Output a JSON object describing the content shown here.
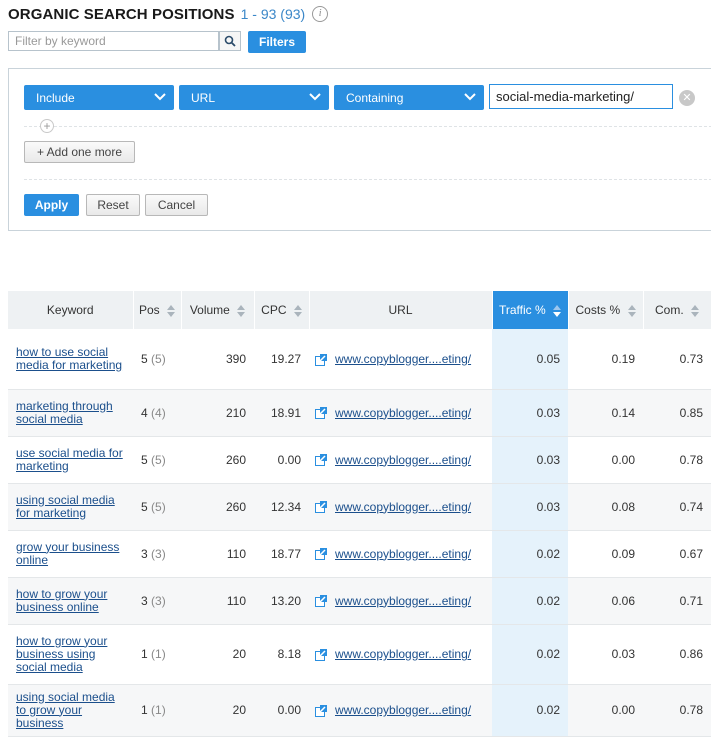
{
  "header": {
    "title": "ORGANIC SEARCH POSITIONS",
    "range": "1 - 93 (93)",
    "info_symbol": "i"
  },
  "search": {
    "placeholder": "Filter by keyword",
    "value": "",
    "filters_label": "Filters"
  },
  "filter_panel": {
    "include": "Include",
    "field": "URL",
    "operator": "Containing",
    "value": "social-media-marketing/",
    "add_symbol": "+",
    "add_one_more": "+ Add one more",
    "apply": "Apply",
    "reset": "Reset",
    "cancel": "Cancel"
  },
  "table": {
    "columns": [
      "Keyword",
      "Pos",
      "Volume",
      "CPC",
      "URL",
      "Traffic %",
      "Costs %",
      "Com."
    ],
    "rows": [
      {
        "keyword": "how to use social media for marketing",
        "pos": "5",
        "pos_prev": "(5)",
        "volume": "390",
        "cpc": "19.27",
        "url": "www.copyblogger....eting/",
        "traffic": "0.05",
        "costs": "0.19",
        "com": "0.73"
      },
      {
        "keyword": "marketing through social media",
        "pos": "4",
        "pos_prev": "(4)",
        "volume": "210",
        "cpc": "18.91",
        "url": "www.copyblogger....eting/",
        "traffic": "0.03",
        "costs": "0.14",
        "com": "0.85"
      },
      {
        "keyword": "use social media for marketing",
        "pos": "5",
        "pos_prev": "(5)",
        "volume": "260",
        "cpc": "0.00",
        "url": "www.copyblogger....eting/",
        "traffic": "0.03",
        "costs": "0.00",
        "com": "0.78"
      },
      {
        "keyword": "using social media for marketing",
        "pos": "5",
        "pos_prev": "(5)",
        "volume": "260",
        "cpc": "12.34",
        "url": "www.copyblogger....eting/",
        "traffic": "0.03",
        "costs": "0.08",
        "com": "0.74"
      },
      {
        "keyword": "grow your business online",
        "pos": "3",
        "pos_prev": "(3)",
        "volume": "110",
        "cpc": "18.77",
        "url": "www.copyblogger....eting/",
        "traffic": "0.02",
        "costs": "0.09",
        "com": "0.67"
      },
      {
        "keyword": "how to grow your business online",
        "pos": "3",
        "pos_prev": "(3)",
        "volume": "110",
        "cpc": "13.20",
        "url": "www.copyblogger....eting/",
        "traffic": "0.02",
        "costs": "0.06",
        "com": "0.71"
      },
      {
        "keyword": "how to grow your business using social media",
        "pos": "1",
        "pos_prev": "(1)",
        "volume": "20",
        "cpc": "8.18",
        "url": "www.copyblogger....eting/",
        "traffic": "0.02",
        "costs": "0.03",
        "com": "0.86"
      },
      {
        "keyword": "using social media to grow your business",
        "pos": "1",
        "pos_prev": "(1)",
        "volume": "20",
        "cpc": "0.00",
        "url": "www.copyblogger....eting/",
        "traffic": "0.02",
        "costs": "0.00",
        "com": "0.78"
      }
    ]
  },
  "colors": {
    "accent": "#2a8fe0",
    "link": "#1b4f8c",
    "active_column_bg": "#e5f2fb"
  }
}
